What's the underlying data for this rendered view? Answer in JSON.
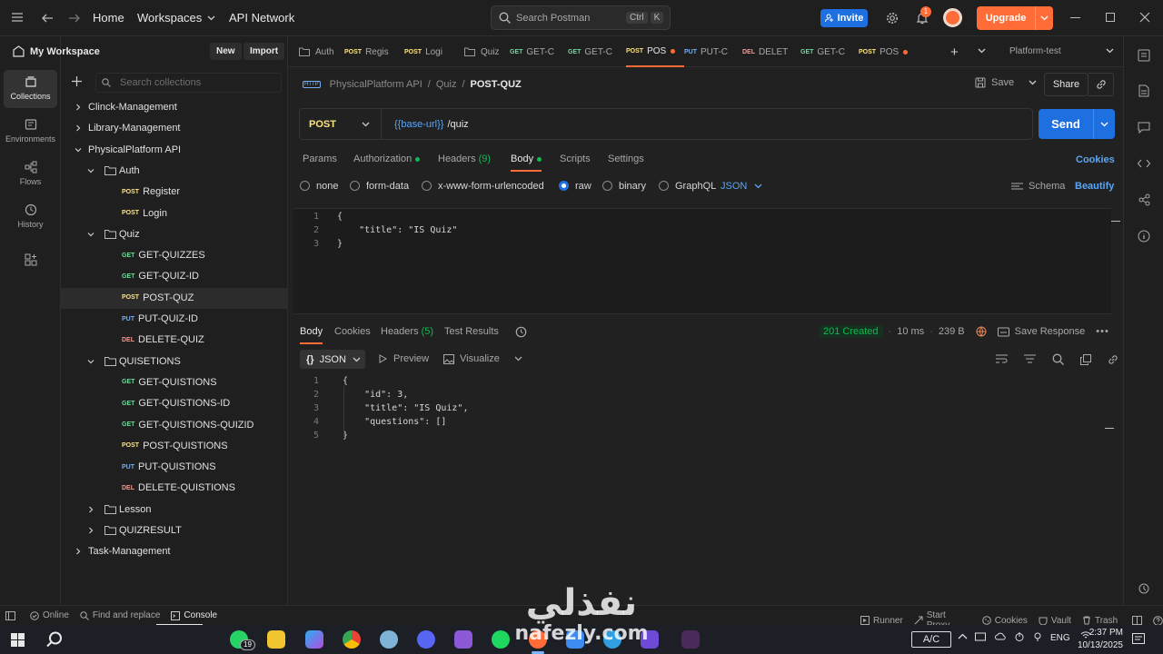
{
  "topbar": {
    "home": "Home",
    "workspaces": "Workspaces",
    "api_network": "API Network",
    "search_placeholder": "Search Postman",
    "shortcut_ctrl": "Ctrl",
    "shortcut_k": "K",
    "invite": "Invite",
    "notification_count": "1",
    "upgrade": "Upgrade"
  },
  "rail": [
    {
      "label": "Collections",
      "icon": "collections-icon",
      "active": true
    },
    {
      "label": "Environments",
      "icon": "environments-icon"
    },
    {
      "label": "Flows",
      "icon": "flows-icon"
    },
    {
      "label": "History",
      "icon": "history-icon"
    },
    {
      "label": "",
      "icon": "apps-icon"
    }
  ],
  "sidebar": {
    "workspace": "My Workspace",
    "new": "New",
    "import": "Import",
    "search_placeholder": "Search collections",
    "tree": [
      {
        "label": "Clinck-Management",
        "level": 0,
        "type": "collection",
        "open": false
      },
      {
        "label": "Library-Management",
        "level": 0,
        "type": "collection",
        "open": false
      },
      {
        "label": "PhysicalPlatform API",
        "level": 0,
        "type": "collection",
        "open": true
      },
      {
        "label": "Auth",
        "level": 1,
        "type": "folder",
        "open": true
      },
      {
        "label": "Register",
        "level": 2,
        "type": "request",
        "method": "POST"
      },
      {
        "label": "Login",
        "level": 2,
        "type": "request",
        "method": "POST"
      },
      {
        "label": "Quiz",
        "level": 1,
        "type": "folder",
        "open": true
      },
      {
        "label": "GET-QUIZZES",
        "level": 2,
        "type": "request",
        "method": "GET"
      },
      {
        "label": "GET-QUIZ-ID",
        "level": 2,
        "type": "request",
        "method": "GET"
      },
      {
        "label": "POST-QUZ",
        "level": 2,
        "type": "request",
        "method": "POST",
        "selected": true
      },
      {
        "label": "PUT-QUIZ-ID",
        "level": 2,
        "type": "request",
        "method": "PUT"
      },
      {
        "label": "DELETE-QUIZ",
        "level": 2,
        "type": "request",
        "method": "DEL"
      },
      {
        "label": "QUISETIONS",
        "level": 1,
        "type": "folder",
        "open": true
      },
      {
        "label": "GET-QUISTIONS",
        "level": 2,
        "type": "request",
        "method": "GET"
      },
      {
        "label": "GET-QUISTIONS-ID",
        "level": 2,
        "type": "request",
        "method": "GET"
      },
      {
        "label": "GET-QUISTIONS-QUIZID",
        "level": 2,
        "type": "request",
        "method": "GET"
      },
      {
        "label": "POST-QUISTIONS",
        "level": 2,
        "type": "request",
        "method": "POST"
      },
      {
        "label": "PUT-QUISTIONS",
        "level": 2,
        "type": "request",
        "method": "PUT"
      },
      {
        "label": "DELETE-QUISTIONS",
        "level": 2,
        "type": "request",
        "method": "DEL"
      },
      {
        "label": "Lesson",
        "level": 1,
        "type": "folder",
        "open": false
      },
      {
        "label": "QUIZRESULT",
        "level": 1,
        "type": "folder",
        "open": false
      },
      {
        "label": "Task-Management",
        "level": 0,
        "type": "collection",
        "open": false
      }
    ]
  },
  "tabs": [
    {
      "method": "",
      "label": "Auth",
      "icon": "folder-icon"
    },
    {
      "method": "POST",
      "label": "Regis"
    },
    {
      "method": "POST",
      "label": "Logi"
    },
    {
      "method": "",
      "label": "Quiz",
      "icon": "folder-icon"
    },
    {
      "method": "GET",
      "label": "GET-C"
    },
    {
      "method": "GET",
      "label": "GET-C"
    },
    {
      "method": "POST",
      "label": "POS",
      "active": true,
      "unsaved": true
    },
    {
      "method": "PUT",
      "label": "PUT-C"
    },
    {
      "method": "DEL",
      "label": "DELET"
    },
    {
      "method": "GET",
      "label": "GET-C"
    },
    {
      "method": "POST",
      "label": "POS",
      "unsaved": true
    }
  ],
  "environment": "Platform-test",
  "breadcrumb": {
    "collection": "PhysicalPlatform API",
    "sep": "/",
    "folder": "Quiz",
    "request": "POST-QUZ"
  },
  "actions": {
    "save": "Save",
    "share": "Share"
  },
  "request": {
    "method": "POST",
    "url_var": "{{base-url}}",
    "url_path": "/quiz",
    "send": "Send",
    "tabs": [
      {
        "label": "Params"
      },
      {
        "label": "Authorization",
        "dot": true
      },
      {
        "label": "Headers",
        "count": "(9)"
      },
      {
        "label": "Body",
        "dot": true,
        "active": true
      },
      {
        "label": "Scripts"
      },
      {
        "label": "Settings"
      }
    ],
    "cookies": "Cookies",
    "body_types": [
      "none",
      "form-data",
      "x-www-form-urlencoded",
      "raw",
      "binary",
      "GraphQL"
    ],
    "body_selected": "raw",
    "format": "JSON",
    "schema": "Schema",
    "beautify": "Beautify",
    "body_lines": [
      "{",
      "    \"title\": \"IS Quiz\"",
      "}"
    ]
  },
  "response": {
    "tabs": [
      {
        "label": "Body",
        "active": true
      },
      {
        "label": "Cookies"
      },
      {
        "label": "Headers",
        "count": "(5)"
      },
      {
        "label": "Test Results"
      }
    ],
    "status": "201 Created",
    "time": "10 ms",
    "size": "239 B",
    "save_response": "Save Response",
    "format": "JSON",
    "preview": "Preview",
    "visualize": "Visualize",
    "body_lines": [
      "{",
      "    \"id\": 3,",
      "    \"title\": \"IS Quiz\",",
      "    \"questions\": []",
      "}"
    ]
  },
  "statusbar": {
    "online": "Online",
    "find_replace": "Find and replace",
    "console": "Console",
    "runner": "Runner",
    "start_proxy": "Start Proxy",
    "cookies": "Cookies",
    "vault": "Vault",
    "trash": "Trash"
  },
  "taskbar": {
    "whatsapp_badge": "19",
    "ac": "A/C",
    "lang": "ENG",
    "time": "2:37 PM",
    "date": "10/13/2025"
  },
  "watermark": {
    "arabic": "نفذلي",
    "latin": "nafezly.com"
  },
  "colors": {
    "accent": "#ff6c37",
    "primary": "#1e6fe0",
    "success": "#0cbb52"
  }
}
